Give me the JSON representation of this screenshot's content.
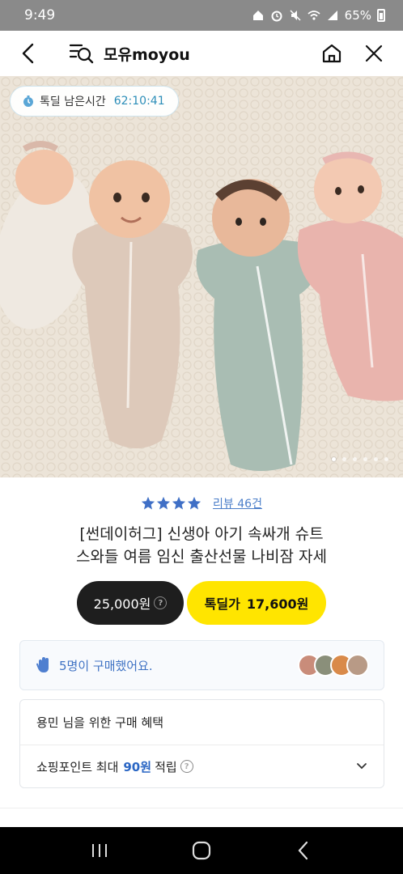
{
  "status_bar": {
    "time": "9:49",
    "battery": "65%"
  },
  "header": {
    "store_name": "모유moyou"
  },
  "hero": {
    "timer_label": "톡딜 남은시간",
    "timer_value": "62:10:41",
    "page_count": 6,
    "active_page": 0
  },
  "product": {
    "rating_stars": 4,
    "review_link": "리뷰 46건",
    "title_line1": "[썬데이허그] 신생아 아기 속싸개 슈트",
    "title_line2": "스와들 여름 임신 출산선물 나비잠 자세",
    "price_original": "25,000원",
    "deal_label": "톡딜가",
    "deal_price": "17,600원"
  },
  "buyers": {
    "text": "5명이 구매했어요."
  },
  "benefits": {
    "title": "용민 님을 위한 구매 혜택",
    "row_prefix": "쇼핑포인트 최대",
    "row_points": "90원",
    "row_suffix": "적립"
  },
  "colors": {
    "accent_blue": "#2b8db8",
    "deal_yellow": "#ffe500",
    "link_blue": "#4b7ec9",
    "star_blue": "#3f6fc6"
  }
}
